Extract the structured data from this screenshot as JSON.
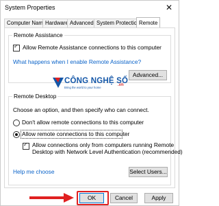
{
  "window": {
    "title": "System Properties",
    "close_glyph": "✕"
  },
  "tabs": [
    {
      "label": "Computer Name",
      "active": false
    },
    {
      "label": "Hardware",
      "active": false
    },
    {
      "label": "Advanced",
      "active": false
    },
    {
      "label": "System Protection",
      "active": false
    },
    {
      "label": "Remote",
      "active": true
    }
  ],
  "remote_assistance": {
    "group_title": "Remote Assistance",
    "allow_checkbox_label": "Allow Remote Assistance connections to this computer",
    "allow_checked": true,
    "help_link": "What happens when I enable Remote Assistance?",
    "advanced_button": "Advanced..."
  },
  "watermark": {
    "name": "CÔNG NGHỆ SỐ",
    "suffix": ".vn",
    "tagline": "Bring the world to your home"
  },
  "remote_desktop": {
    "group_title": "Remote Desktop",
    "instruction": "Choose an option, and then specify who can connect.",
    "option_dont_allow": "Don't allow remote connections to this computer",
    "option_allow": "Allow remote connections to this computer",
    "selected_option": "allow",
    "nla_checkbox_line1": "Allow connections only from computers running Remote",
    "nla_checkbox_line2": "Desktop with Network Level Authentication (recommended)",
    "nla_checked": true,
    "help_link": "Help me choose",
    "select_users_button": "Select Users..."
  },
  "footer": {
    "ok_button": "OK",
    "cancel_button": "Cancel",
    "apply_button": "Apply"
  },
  "colors": {
    "link": "#0a63c9",
    "highlight": "#e02020",
    "primary_border": "#0078d7"
  }
}
